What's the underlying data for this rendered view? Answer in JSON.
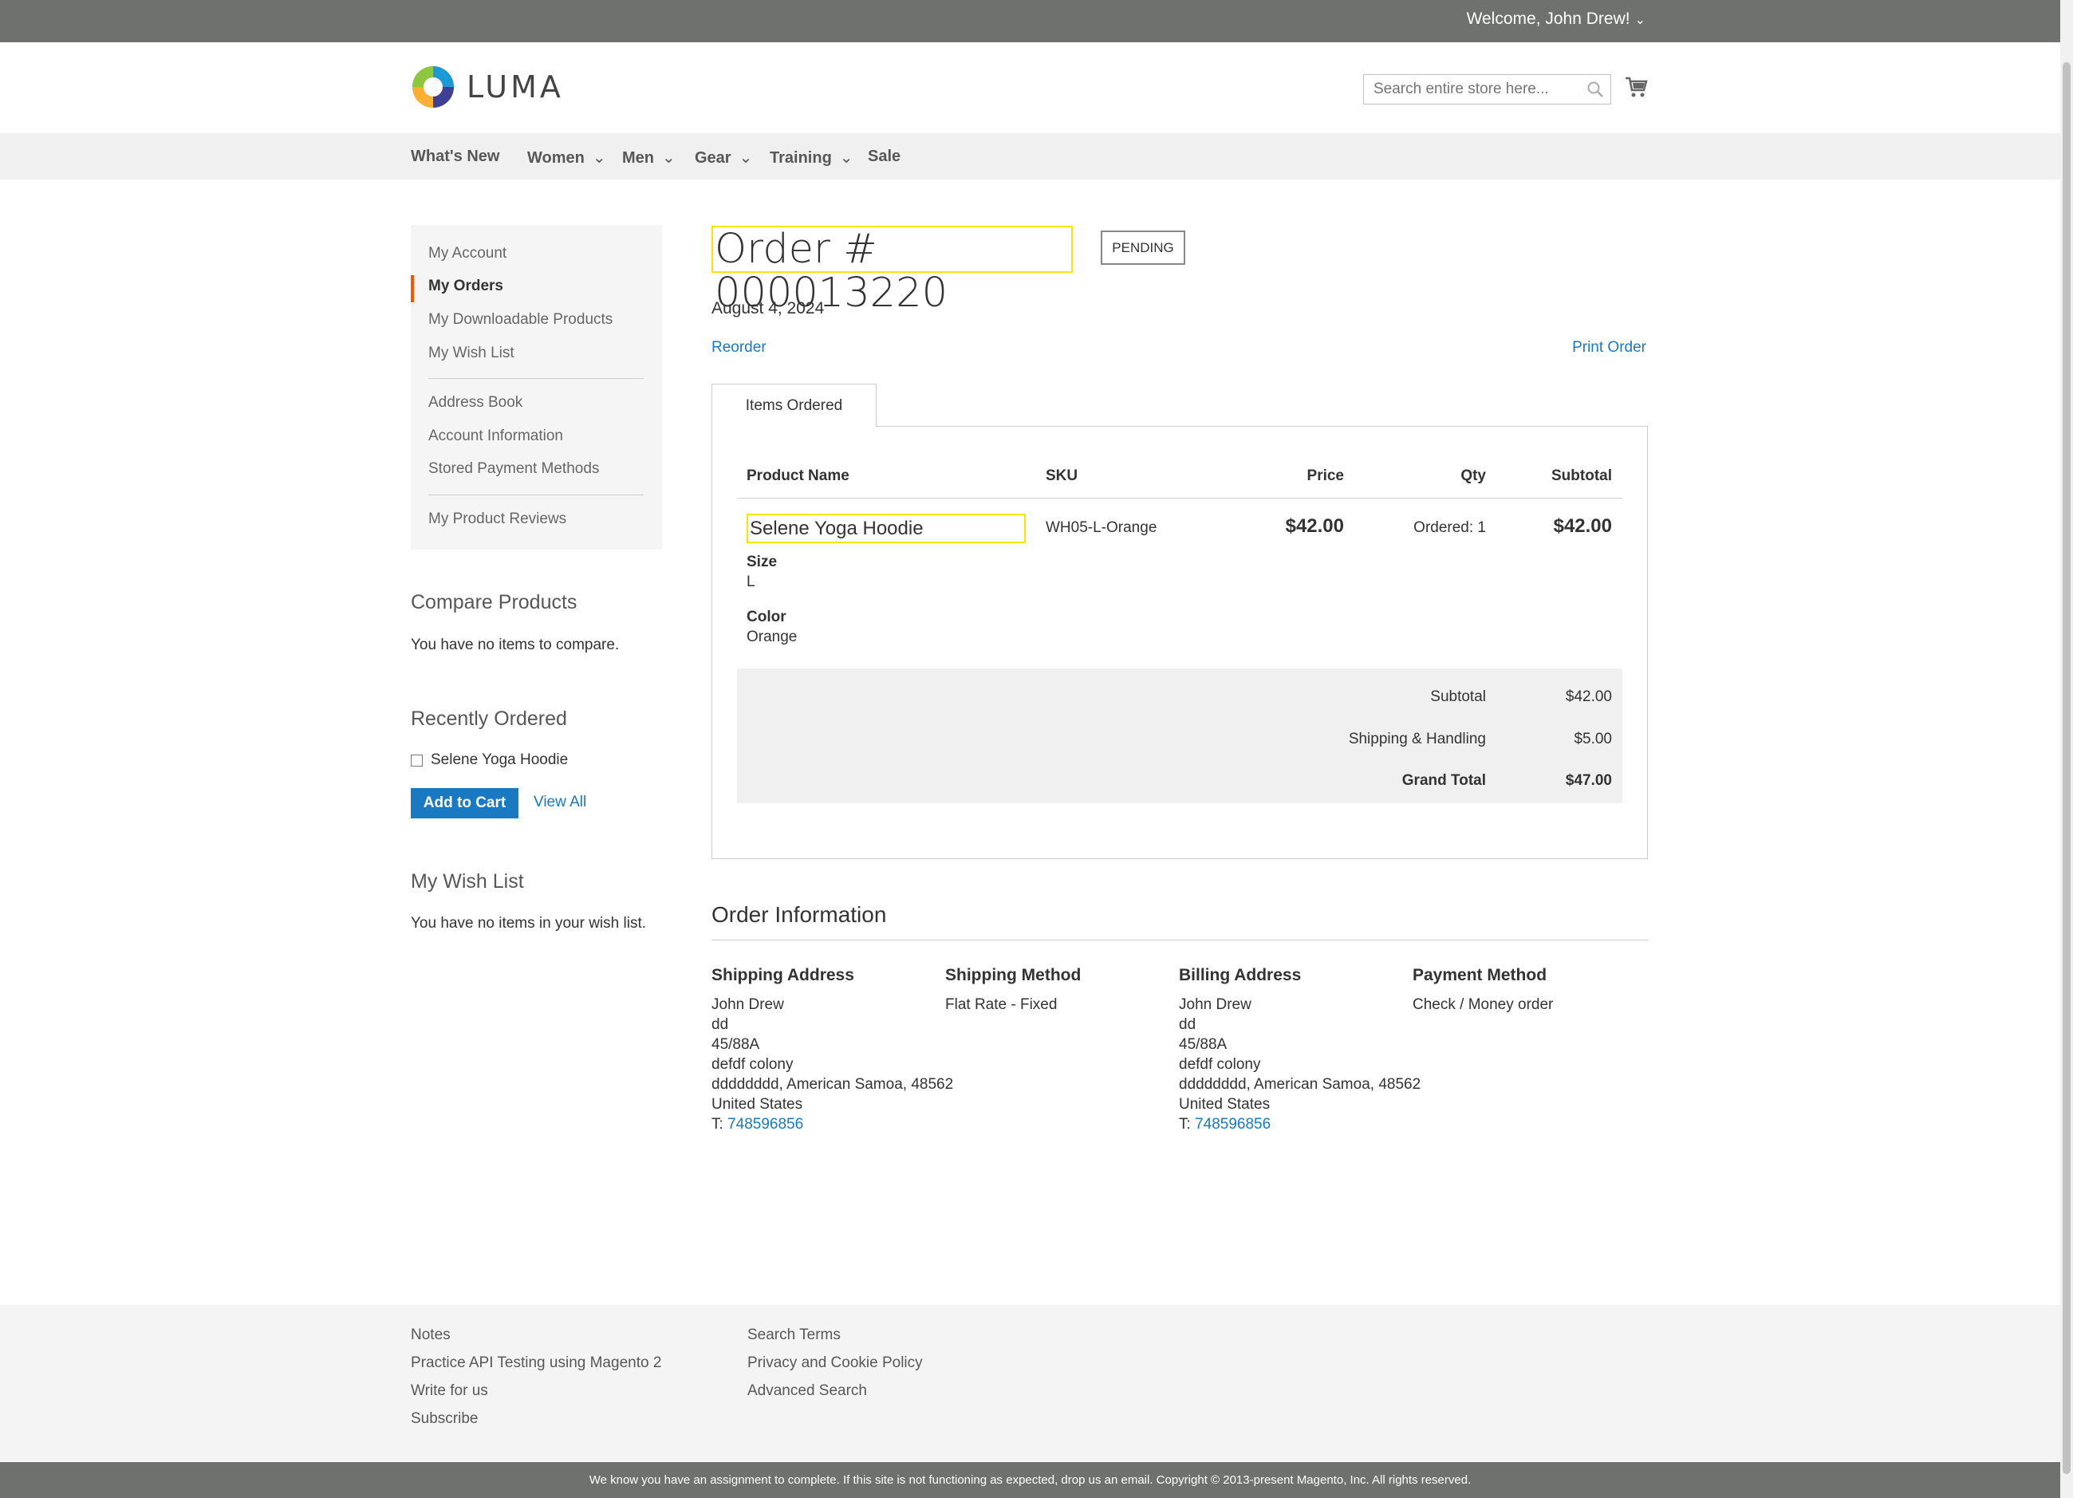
{
  "topbar": {
    "welcome": "Welcome, John Drew!"
  },
  "header": {
    "logo_text": "LUMA",
    "search_placeholder": "Search entire store here..."
  },
  "nav": {
    "items": [
      {
        "label": "What's New"
      },
      {
        "label": "Women"
      },
      {
        "label": "Men"
      },
      {
        "label": "Gear"
      },
      {
        "label": "Training"
      },
      {
        "label": "Sale"
      }
    ]
  },
  "sidebar": {
    "links": [
      {
        "label": "My Account"
      },
      {
        "label": "My Orders"
      },
      {
        "label": "My Downloadable Products"
      },
      {
        "label": "My Wish List"
      },
      {
        "label": "Address Book"
      },
      {
        "label": "Account Information"
      },
      {
        "label": "Stored Payment Methods"
      },
      {
        "label": "My Product Reviews"
      }
    ],
    "compare": {
      "title": "Compare Products",
      "text": "You have no items to compare."
    },
    "recent": {
      "title": "Recently Ordered",
      "item": "Selene Yoga Hoodie",
      "add_to_cart": "Add to Cart",
      "view_all": "View All"
    },
    "wishlist": {
      "title": "My Wish List",
      "text": "You have no items in your wish list."
    }
  },
  "order": {
    "title": "Order # 000013220",
    "status": "PENDING",
    "date": "August 4, 2024",
    "reorder": "Reorder",
    "print": "Print Order",
    "tab": "Items Ordered",
    "columns": {
      "product": "Product Name",
      "sku": "SKU",
      "price": "Price",
      "qty": "Qty",
      "subtotal": "Subtotal"
    },
    "item": {
      "name": "Selene Yoga Hoodie",
      "sku": "WH05-L-Orange",
      "price": "$42.00",
      "qty": "Ordered: 1",
      "subtotal": "$42.00",
      "options": [
        {
          "label": "Size",
          "value": "L"
        },
        {
          "label": "Color",
          "value": "Orange"
        }
      ]
    },
    "totals": [
      {
        "label": "Subtotal",
        "value": "$42.00"
      },
      {
        "label": "Shipping & Handling",
        "value": "$5.00"
      },
      {
        "label": "Grand Total",
        "value": "$47.00"
      }
    ]
  },
  "info": {
    "title": "Order Information",
    "shipping_address": {
      "title": "Shipping Address",
      "lines": [
        "John Drew",
        "dd",
        "45/88A",
        "defdf colony",
        "dddddddd, American Samoa, 48562",
        "United States"
      ],
      "phone_prefix": "T: ",
      "phone": "748596856"
    },
    "shipping_method": {
      "title": "Shipping Method",
      "value": "Flat Rate - Fixed"
    },
    "billing_address": {
      "title": "Billing Address",
      "lines": [
        "John Drew",
        "dd",
        "45/88A",
        "defdf colony",
        "dddddddd, American Samoa, 48562",
        "United States"
      ],
      "phone_prefix": "T: ",
      "phone": "748596856"
    },
    "payment_method": {
      "title": "Payment Method",
      "value": "Check / Money order"
    }
  },
  "footer": {
    "col1": [
      "Notes",
      "Practice API Testing using Magento 2",
      "Write for us",
      "Subscribe"
    ],
    "col2": [
      "Search Terms",
      "Privacy and Cookie Policy",
      "Advanced Search"
    ],
    "copyright": "We know you have an assignment to complete. If this site is not functioning as expected, drop us an email. Copyright © 2013-present Magento, Inc. All rights reserved."
  },
  "colors": {
    "accent": "#1979c3",
    "active_marker": "#ff5501",
    "highlight": "#f6e600",
    "topbar": "#6e716e"
  }
}
